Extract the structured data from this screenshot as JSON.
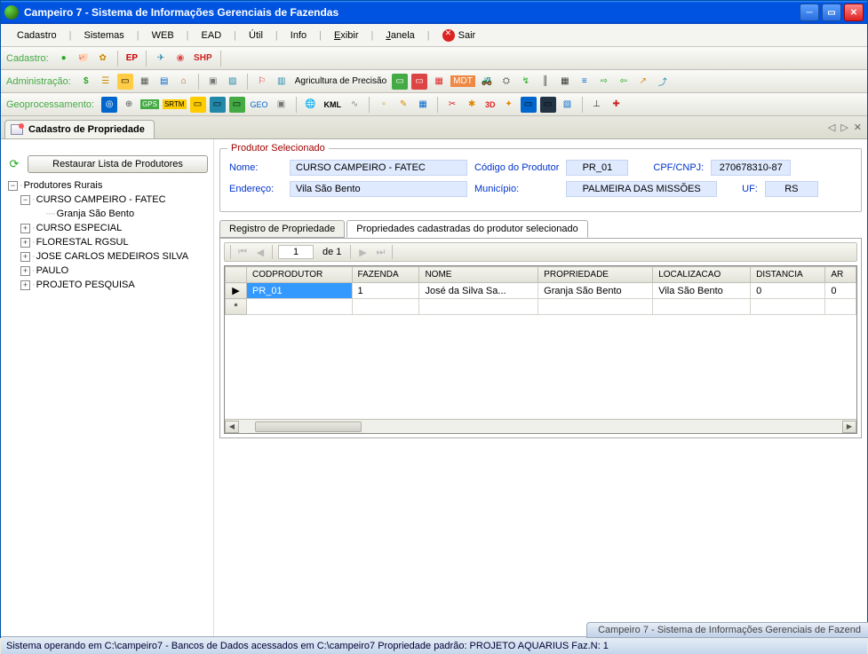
{
  "window": {
    "title": "Campeiro 7 - Sistema de Informações Gerenciais de Fazendas"
  },
  "menu": {
    "items": [
      "Cadastro",
      "Sistemas",
      "WEB",
      "EAD",
      "Útil",
      "Info"
    ],
    "exibir": "Exibir",
    "janela": "Janela",
    "sair": "Sair"
  },
  "toolbars": {
    "cadastro_label": "Cadastro:",
    "cadastro_items": [
      "EP",
      "SHP"
    ],
    "admin_label": "Administração:",
    "admin_text": "Agricultura de Precisão",
    "admin_badge": "MDT",
    "geo_label": "Geoprocessamento:",
    "geo_items": [
      "GPS",
      "SRTM",
      "GEO",
      "KML",
      "3D"
    ]
  },
  "doc_tab": "Cadastro de Propriedade",
  "sidebar": {
    "restore_btn": "Restaurar Lista de Produtores",
    "root": "Produtores Rurais",
    "nodes": [
      {
        "label": "CURSO CAMPEIRO - FATEC",
        "children": [
          "Granja São Bento"
        ],
        "expanded": true
      },
      {
        "label": "CURSO ESPECIAL",
        "expanded": false
      },
      {
        "label": "FLORESTAL RGSUL",
        "expanded": false
      },
      {
        "label": "JOSE CARLOS MEDEIROS SILVA",
        "expanded": false
      },
      {
        "label": "PAULO",
        "expanded": false
      },
      {
        "label": "PROJETO PESQUISA",
        "expanded": false
      }
    ]
  },
  "producer": {
    "legend": "Produtor Selecionado",
    "nome_lbl": "Nome:",
    "nome": "CURSO CAMPEIRO - FATEC",
    "codigo_lbl": "Código do Produtor",
    "codigo": "PR_01",
    "cpf_lbl": "CPF/CNPJ:",
    "cpf": "270678310-87",
    "endereco_lbl": "Endereço:",
    "endereco": "Vila São Bento",
    "municipio_lbl": "Município:",
    "municipio": "PALMEIRA DAS MISSÕES",
    "uf_lbl": "UF:",
    "uf": "RS"
  },
  "subtabs": {
    "reg": "Registro de Propriedade",
    "cad": "Propriedades cadastradas do produtor selecionado"
  },
  "pager": {
    "page": "1",
    "of": "de 1"
  },
  "grid": {
    "columns": [
      "CODPRODUTOR",
      "FAZENDA",
      "NOME",
      "PROPRIEDADE",
      "LOCALIZACAO",
      "DISTANCIA",
      "AR"
    ],
    "rows": [
      {
        "codprodutor": "PR_01",
        "fazenda": "1",
        "nome": "José da Silva Sa...",
        "propriedade": "Granja São Bento",
        "localizacao": "Vila São Bento",
        "distancia": "0",
        "ar": "0"
      }
    ]
  },
  "status": "Sistema operando em C:\\campeiro7  -  Bancos de Dados acessados em C:\\campeiro7  Propriedade padrão: PROJETO AQUARIUS Faz.N:  1",
  "taskbar_hint": "Campeiro 7 - Sistema de Informações Gerenciais de Fazend"
}
